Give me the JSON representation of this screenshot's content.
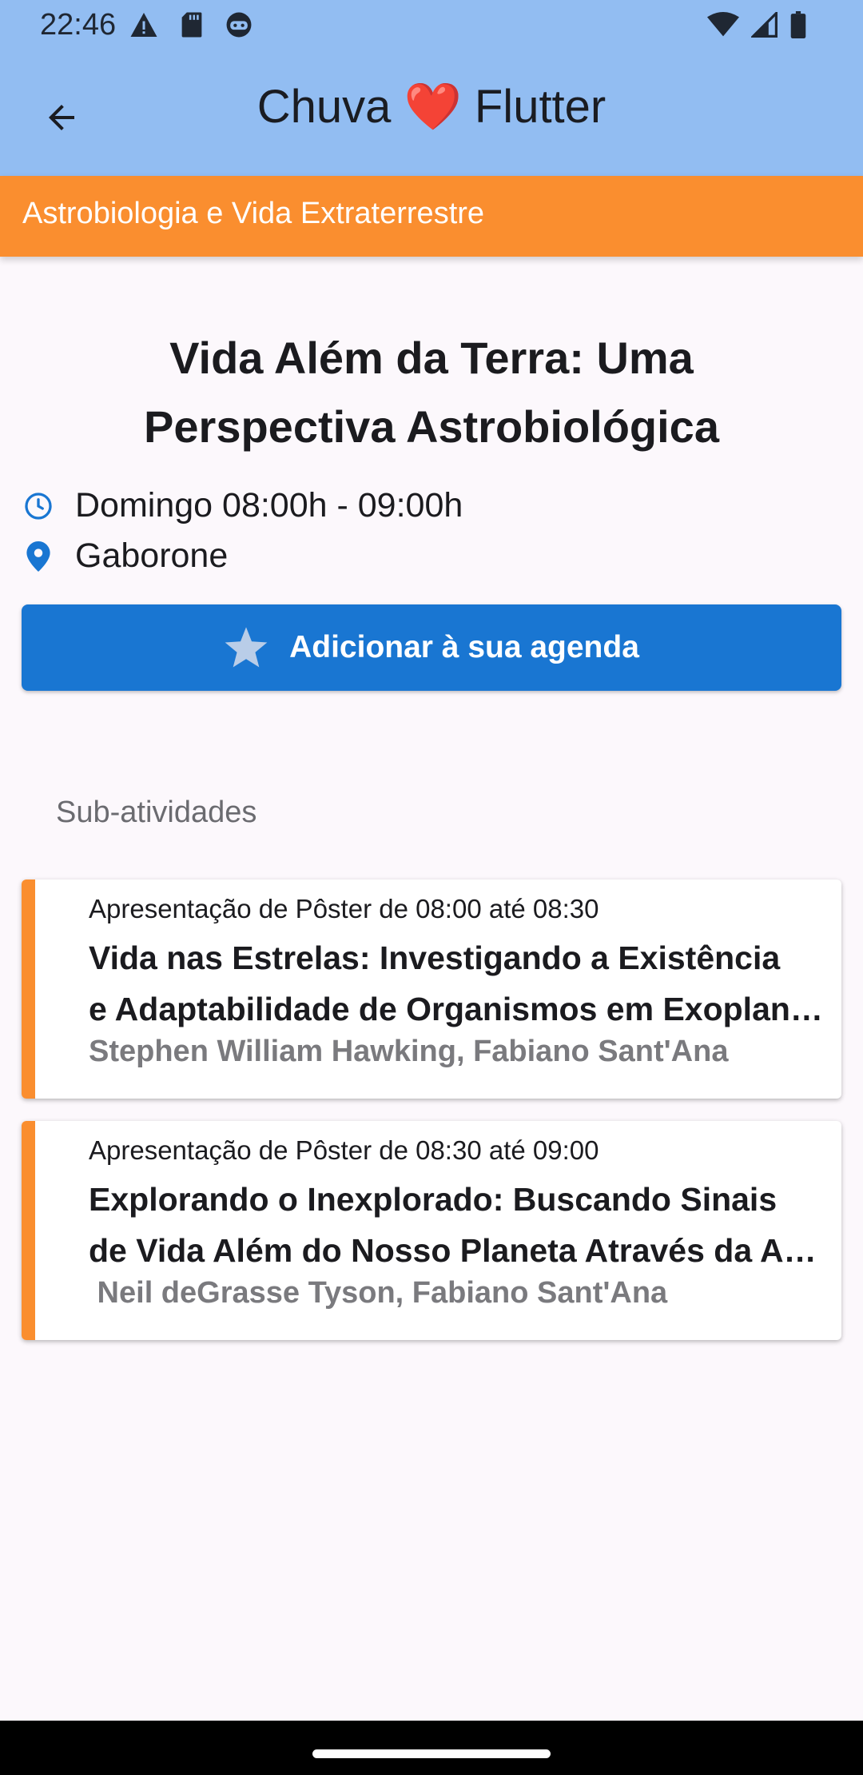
{
  "status_bar": {
    "time": "22:46",
    "left_icons": [
      "warning-icon",
      "sd-card-icon",
      "android-head-icon"
    ],
    "right_icons": [
      "wifi-icon",
      "signal-icon",
      "battery-icon"
    ]
  },
  "app_bar": {
    "title_left": "Chuva",
    "title_heart": "❤️",
    "title_right": "Flutter",
    "background": "#92bdf2"
  },
  "category": {
    "label": "Astrobiologia e Vida Extraterrestre",
    "color": "#fa8e2f"
  },
  "activity": {
    "title_line1": "Vida Além da Terra: Uma",
    "title_line2": "Perspectiva Astrobiológica",
    "time": "Domingo 08:00h - 09:00h",
    "location": "Gaborone",
    "agenda_button": "Adicionar à sua agenda",
    "accent": "#1976d2"
  },
  "sub_activities": {
    "label": "Sub-atividades",
    "items": [
      {
        "kind": "Apresentação de Pôster de 08:00 até 08:30",
        "title_line1": "Vida nas Estrelas: Investigando a Existência",
        "title_line2": "e Adaptabilidade de Organismos em Exoplanetas",
        "authors": "Stephen William Hawking, Fabiano Sant'Ana"
      },
      {
        "kind": "Apresentação de Pôster de 08:30 até 09:00",
        "title_line1": "Explorando o Inexplorado: Buscando Sinais",
        "title_line2": "de Vida Além do Nosso Planeta Através da Astrobiologia",
        "authors": " Neil deGrasse Tyson, Fabiano Sant'Ana"
      }
    ]
  }
}
